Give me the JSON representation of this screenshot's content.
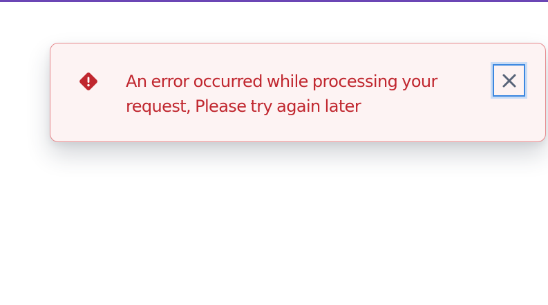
{
  "colors": {
    "top_bar": "#6b46b5",
    "toast_background": "#fdf3f3",
    "toast_border": "#e6898d",
    "error_text": "#c0262e",
    "error_icon": "#c0262e",
    "close_icon": "#586478",
    "focus_ring": "#3b87e0"
  },
  "toast": {
    "type": "error",
    "icon": "error-diamond-icon",
    "message": "An error occurred while processing your request, Please try again later",
    "close_icon": "close-icon"
  }
}
